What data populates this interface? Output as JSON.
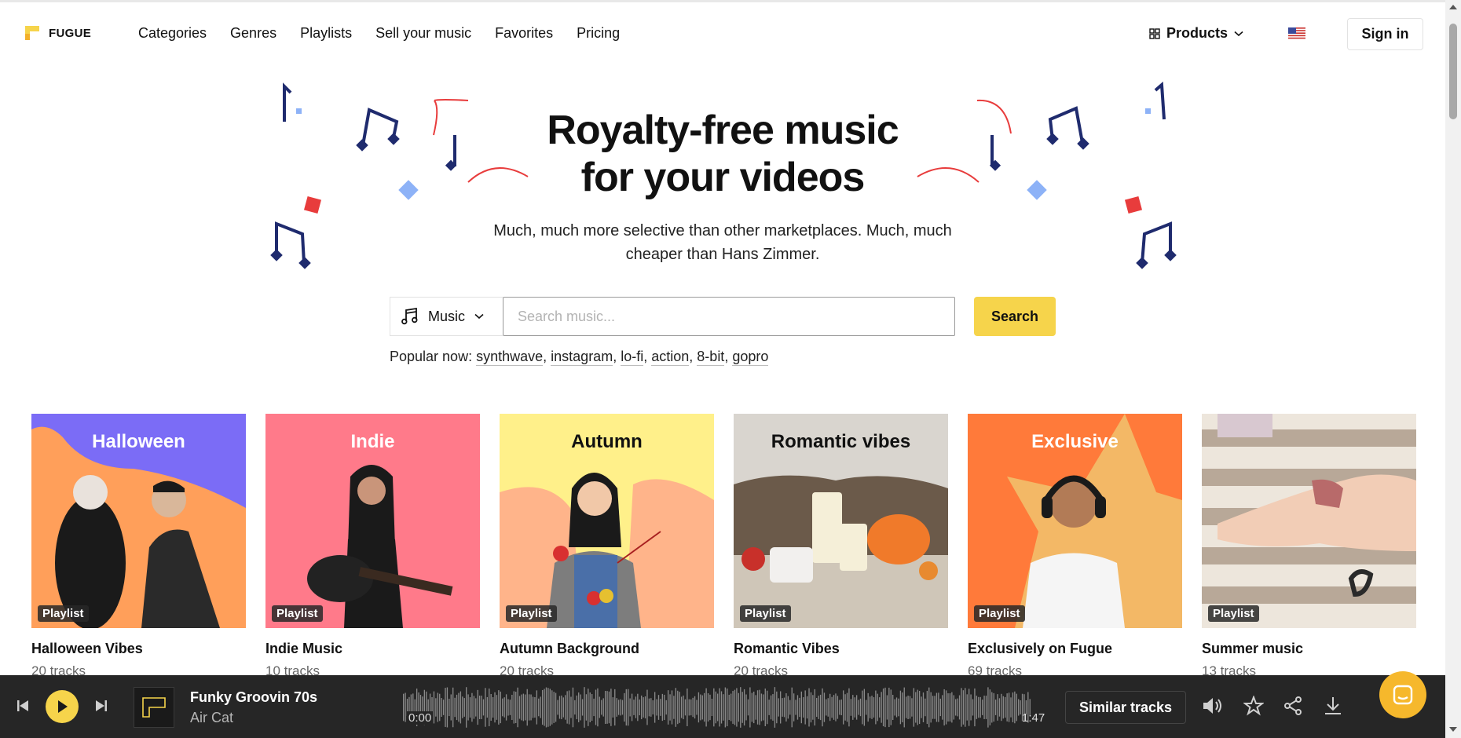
{
  "brand": {
    "name": "FUGUE",
    "accent": "#f6d44b"
  },
  "nav": {
    "items": [
      "Categories",
      "Genres",
      "Playlists",
      "Sell your music",
      "Favorites",
      "Pricing"
    ]
  },
  "header": {
    "products_label": "Products",
    "signin_label": "Sign in",
    "locale_flag": "us-flag-icon"
  },
  "hero": {
    "title_line1": "Royalty-free music",
    "title_line2": "for your videos",
    "subtitle": "Much, much more selective than other marketplaces. Much, much cheaper than Hans Zimmer."
  },
  "search": {
    "type_label": "Music",
    "placeholder": "Search music...",
    "value": "",
    "button_label": "Search",
    "popular_label": "Popular now:",
    "popular_tags": [
      "synthwave",
      "instagram",
      "lo-fi",
      "action",
      "8-bit",
      "gopro"
    ]
  },
  "playlists": [
    {
      "cover_title": "Halloween",
      "badge": "Playlist",
      "name": "Halloween Vibes",
      "count": "20 tracks",
      "bg": "#ff9f5a",
      "accent": "#7b6cf6",
      "title_color": "#ffffff"
    },
    {
      "cover_title": "Indie",
      "badge": "Playlist",
      "name": "Indie Music",
      "count": "10 tracks",
      "bg": "#ff7a8a",
      "accent": "#ff7a8a",
      "title_color": "#ffffff"
    },
    {
      "cover_title": "Autumn",
      "badge": "Playlist",
      "name": "Autumn Background",
      "count": "20 tracks",
      "bg": "#fff08a",
      "accent": "#ffb48a",
      "title_color": "#111111"
    },
    {
      "cover_title": "Romantic vibes",
      "badge": "Playlist",
      "name": "Romantic Vibes",
      "count": "20 tracks",
      "bg": "#d9d5cf",
      "accent": "#f07a2a",
      "title_color": "#111111"
    },
    {
      "cover_title": "Exclusive",
      "badge": "Playlist",
      "name": "Exclusively on Fugue",
      "count": "69 tracks",
      "bg": "#ff7a3a",
      "accent": "#f3b866",
      "title_color": "#ffffff"
    },
    {
      "cover_title": "",
      "badge": "Playlist",
      "name": "Summer music",
      "count": "13 tracks",
      "bg": "#ede6dc",
      "accent": "#b8a898",
      "title_color": "#111111"
    }
  ],
  "player": {
    "track_title": "Funky Groovin 70s",
    "artist": "Air Cat",
    "time_current": "0:00",
    "time_total": "1:47",
    "progress": 0,
    "similar_label": "Similar tracks"
  }
}
